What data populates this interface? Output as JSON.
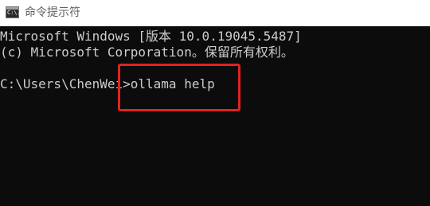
{
  "window": {
    "title": "命令提示符",
    "icon": "cmd-icon",
    "icon_glyph": "C:\\."
  },
  "console": {
    "lines": [
      "Microsoft Windows [版本 10.0.19045.5487]",
      "(c) Microsoft Corporation。保留所有权利。",
      "",
      "C:\\Users\\ChenWei>ollama help"
    ]
  },
  "annotation": {
    "color": "#e02222"
  }
}
